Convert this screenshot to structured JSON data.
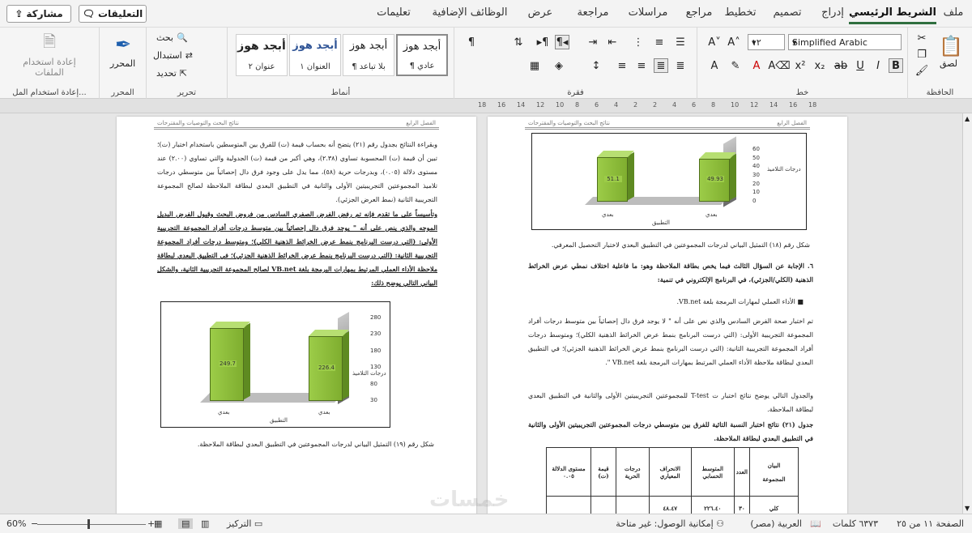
{
  "tabs": [
    "ملف",
    "الشريط الرئيسي",
    "إدراج",
    "تصميم",
    "تخطيط",
    "مراجع",
    "مراسلات",
    "مراجعة",
    "عرض",
    "الوظائف الإضافية",
    "تعليمات"
  ],
  "top_buttons": {
    "share": "مشاركة",
    "comments": "التعليقات"
  },
  "ribbon": {
    "clipboard": {
      "label": "الحافظة",
      "paste": "لصق"
    },
    "font": {
      "label": "خط",
      "name": "Simplified Arabic",
      "size": "١٢"
    },
    "paragraph": {
      "label": "فقرة"
    },
    "styles": {
      "label": "أنماط",
      "items": [
        {
          "sample": "أبجد هوز",
          "name": "¶ عادي"
        },
        {
          "sample": "أبجد هوز",
          "name": "¶ بلا تباعد"
        },
        {
          "sample": "أبجد هوز",
          "name": "العنوان ١"
        },
        {
          "sample": "أبجد هوز",
          "name": "عنوان ٢"
        }
      ]
    },
    "editing": {
      "label": "تحرير",
      "find": "بحث",
      "replace": "استبدال",
      "select": "تحديد"
    },
    "editor": {
      "label": "المحرر",
      "button": "المحرر"
    },
    "reuse": {
      "label": "إعادة استخدام المل...",
      "button_line1": "إعادة استخدام",
      "button_line2": "الملفات"
    }
  },
  "ruler": {
    "numbers": [
      "18",
      "16",
      "14",
      "12",
      "10",
      "8",
      "6",
      "4",
      "2",
      "2",
      "4",
      "6",
      "8",
      "10",
      "12",
      "14",
      "16",
      "18"
    ]
  },
  "right_page": {
    "header_left": "الفصل الرابع",
    "header_right": "نتائج البحث والتوصيات والمقترحات",
    "chart_caption": "شكل رقم (١٨) التمثيل البياني لدرجات المجموعتين في التطبيق البعدي لاختبار التحصيل المعرفي.",
    "item6": "٦. الإجابة عن السؤال الثالث فيما يخص بطاقة الملاحظة وهو: ما فاعلية اختلاف نمطي عرض الخرائط الذهنية (الكلي/الجزئي)، في البرنامج الإلكتروني في تنمية:",
    "bullet": "الأداء العملي لمهارات البرمجة بلغة VB.net.",
    "p1": "تم اختبار صحة الفرض السادس والذي نص على أنه \" لا يوجد فرق دال إحصائياً بين متوسط درجات أفراد المجموعة التجريبية الأولى: (التي درست البرنامج بنمط عرض الخرائط الذهنية الكلي)؛ ومتوسط درجات أفراد المجموعة التجريبية الثانية: (التي درست البرنامج بنمط عرض الخرائط الذهنية الجزئي)؛ في التطبيق البعدي لبطاقة ملاحظة الأداء العملي المرتبط بمهارات البرمجة بلغة VB.net \".",
    "p2": "والجدول التالي يوضح نتائج اختبار ت T-test للمجموعتين التجريبيتين الأولى والثانية في التطبيق البعدي لبطاقة الملاحظة.",
    "table_title": "جدول (٢١) نتائج اختبار النسبة التائية للفرق بين متوسطي درجات المجموعتين التجريبيتين الأولى والثانية في التطبيق البعدي لبطاقة الملاحظة.",
    "table": {
      "headers": [
        "البيان",
        "العدد",
        "المتوسط الحسابي",
        "الانحراف المعياري",
        "درجات الحرية",
        "قيمة (ت)",
        "مستوى الدلالة ٠.٠٥"
      ],
      "header_sub": "المجموعة",
      "row": [
        "كلي",
        "٣٠",
        "٢٢٦.٤٠",
        "٤٨.٤٧",
        "",
        "",
        ""
      ]
    }
  },
  "left_page": {
    "header_left": "الفصل الرابع",
    "header_right": "نتائج البحث والتوصيات والمقترحات",
    "p1": "وبقراءة النتائج بجدول رقم (٢١) يتضح أنه بحساب قيمة (ت) للفرق بين المتوسطين باستخدام اختبار (ت)؛ تبين أن قيمة (ت) المحسوبة تساوي (٢.٣٨)، وهي أكبر من قيمة (ت) الجدولية والتي تساوي (٢.٠٠) عند مستوى دلالة (٠.٠٥)، وبدرجات حرية (٥٨)، مما يدل على وجود فرق دال إحصائياً بين متوسطي درجات تلاميذ المجموعتين التجريبيتين الأولى والثانية في التطبيق البعدي لبطاقة الملاحظة لصالح المجموعة التجريبية الثانية (نمط العرض الجزئي).",
    "p2": "وتأسيساً على ما تقدم فإنه تم رفض الفرض الصفري السادس من فروض البحث وقبول الفرض البديل الموجه والذي ينص على أنه \" يوجد فرق دال إحصائياً بين متوسط درجات أفراد المجموعة التجريبية الأولى: (التي درست البرنامج بنمط عرض الخرائط الذهنية الكلي)؛ ومتوسط درجات أفراد المجموعة التجريبية الثانية: (التي درست البرنامج بنمط عرض الخرائط الذهنية الجزئي)؛ في التطبيق البعدي لبطاقة ملاحظة الأداء العملي المرتبط بمهارات البرمجة بلغة VB.net لصالح المجموعة التجريبية الثانية، والشكل البياني التالي يوضح ذلك:",
    "chart_caption": "شكل رقم (١٩) التمثيل البياني لدرجات المجموعتين في التطبيق البعدي لبطاقة الملاحظة."
  },
  "chart_data": [
    {
      "type": "bar",
      "categories": [
        "بعدي",
        "بعدي"
      ],
      "values": [
        51.1,
        49.93
      ],
      "ylim": [
        0,
        60
      ],
      "yticks": [
        0,
        10,
        20,
        30,
        40,
        50,
        60
      ],
      "ylabel": "درجات التلاميذ",
      "xlabel": "التطبيق"
    },
    {
      "type": "bar",
      "categories": [
        "بعدي",
        "بعدي"
      ],
      "values": [
        249.7,
        226.4
      ],
      "ylim": [
        30,
        280
      ],
      "yticks": [
        30,
        80,
        130,
        180,
        230,
        280
      ],
      "ylabel": "درجات التلاميذ",
      "xlabel": "التطبيق"
    }
  ],
  "watermark": "خمسات",
  "status": {
    "page": "الصفحة ١١ من ٢٥",
    "words": "٦٣٧٣ كلمات",
    "language": "العربية (مصر)",
    "accessibility": "إمكانية الوصول: غير متاحة",
    "focus": "التركيز",
    "zoom": "60%"
  },
  "colors": {
    "accent": "#2f6f3f",
    "bar": "#8bbf3a"
  }
}
